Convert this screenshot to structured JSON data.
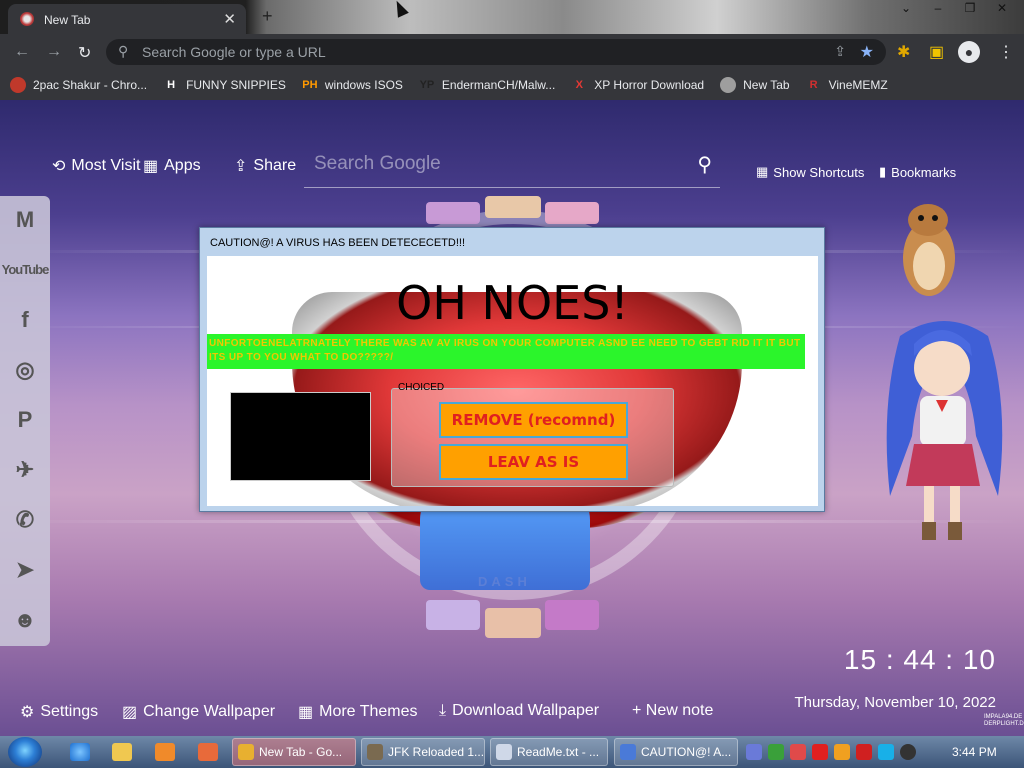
{
  "browser": {
    "tab_title": "New Tab",
    "tab_close": "✕",
    "new_tab": "+",
    "omnibox_placeholder": "Search Google or type a URL",
    "window_controls": [
      "–",
      "❐",
      "✕"
    ]
  },
  "bookmarks": [
    {
      "label": "2pac Shakur - Chro...",
      "icon": "pac-icon",
      "icon_text": "",
      "color": "#c0392b"
    },
    {
      "label": "FUNNY SNIPPIES",
      "icon": "h-icon",
      "icon_text": "H",
      "color": "#ffffff"
    },
    {
      "label": "windows ISOS",
      "icon": "ph-icon",
      "icon_text": "PH",
      "color": "#ff9900"
    },
    {
      "label": "EndermanCH/Malw...",
      "icon": "yp-icon",
      "icon_text": "YP",
      "color": "#222222"
    },
    {
      "label": "XP Horror Download",
      "icon": "x-icon",
      "icon_text": "X",
      "color": "#e53935"
    },
    {
      "label": "New Tab",
      "icon": "globe-icon",
      "icon_text": "",
      "color": "#9e9e9e"
    },
    {
      "label": "VineMEMZ",
      "icon": "r-icon",
      "icon_text": "R",
      "color": "#d32f2f"
    }
  ],
  "newtab": {
    "most_visited": "Most Visit",
    "apps": "Apps",
    "share": "Share",
    "search_placeholder": "Search Google",
    "show_shortcuts": "Show Shortcuts",
    "bookmarks": "Bookmarks",
    "emblem_label": "DASH",
    "clock": "15 : 44 : 10",
    "date": "Thursday, November 10, 2022",
    "corner_text": "IMPALA94.DE DERPLIGHT.DE",
    "settings": "Settings",
    "change_wallpaper": "Change Wallpaper",
    "more_themes": "More Themes",
    "download_wallpaper": "Download Wallpaper",
    "new_note": "+ New note",
    "social": [
      "gmail-icon",
      "youtube-icon",
      "facebook-icon",
      "instagram-icon",
      "pinterest-icon",
      "twitter-icon",
      "whatsapp-icon",
      "telegram-icon",
      "reddit-icon"
    ],
    "youtube_text": "YouTube"
  },
  "dialog": {
    "caption": "CAUTION@! A VIRUS HAS BEEN DETECECETD!!!",
    "title": "OH NOES!",
    "message": "UNFORTOENELATRNATELY THERE WAS AV AV IRUS ON YOUR COMPUTER ASND EE NEED TO GEBT RID IT IT BUT ITS UP TO YOU WHAT TO DO?????/",
    "group_label": "CHOICED",
    "remove_button": "REMOVE (recomnd)",
    "leave_button": "LEAV AS IS"
  },
  "taskbar": {
    "tasks": [
      {
        "label": "New Tab - Go...",
        "active": true
      },
      {
        "label": "JFK Reloaded 1...",
        "active": false
      },
      {
        "label": "ReadMe.txt - ...",
        "active": false
      },
      {
        "label": "CAUTION@! A...",
        "active": false
      }
    ],
    "time": "3:44 PM"
  }
}
